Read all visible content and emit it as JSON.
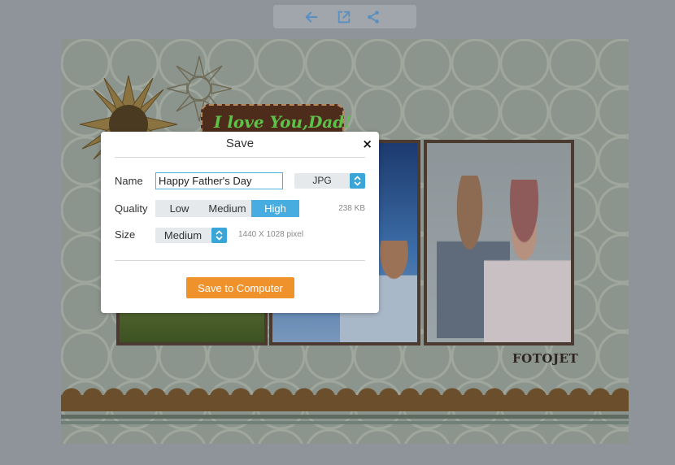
{
  "toolbar": {
    "icons": [
      "back-arrow-icon",
      "open-external-icon",
      "share-icon"
    ]
  },
  "canvas": {
    "banner_text": "I love You,Dad!",
    "brand": "FOTOJET"
  },
  "dialog": {
    "title": "Save",
    "close_label": "×",
    "name_label": "Name",
    "name_value": "Happy Father's Day",
    "format_value": "JPG",
    "quality_label": "Quality",
    "quality_options": [
      "Low",
      "Medium",
      "High"
    ],
    "quality_selected": "High",
    "file_size": "238 KB",
    "size_label": "Size",
    "size_value": "Medium",
    "size_dimensions": "1440 X 1028 pixel",
    "save_button": "Save to Computer"
  },
  "colors": {
    "accent": "#47ade0",
    "save_button": "#f0922b",
    "banner_text": "#5cc24a"
  }
}
